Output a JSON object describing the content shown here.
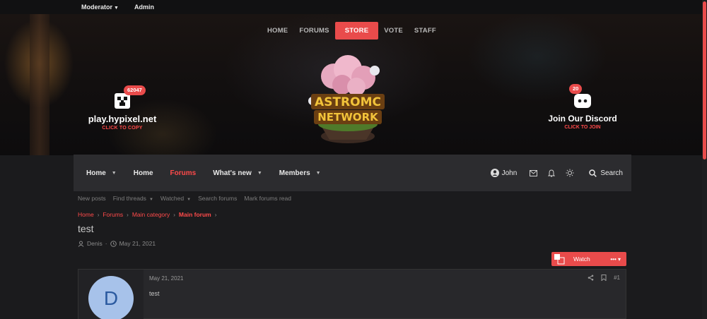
{
  "adminbar": {
    "moderator": "Moderator",
    "admin": "Admin"
  },
  "nav": {
    "home": "HOME",
    "forums": "FORUMS",
    "store": "STORE",
    "vote": "VOTE",
    "staff": "STAFF"
  },
  "server": {
    "title": "play.hypixel.net",
    "sub": "CLICK TO COPY",
    "badge": "62047"
  },
  "discord": {
    "title": "Join Our Discord",
    "sub": "CLICK TO JOIN",
    "badge": "20"
  },
  "logo": {
    "alt": "ASTROMC NETWORK"
  },
  "mainnav": {
    "tabs": [
      "Home",
      "Home",
      "Forums",
      "What's new",
      "Members"
    ],
    "user": "John",
    "search": "Search"
  },
  "subnav": [
    "New posts",
    "Find threads",
    "Watched",
    "Search forums",
    "Mark forums read"
  ],
  "breadcrumb": [
    "Home",
    "Forums",
    "Main category",
    "Main forum"
  ],
  "thread": {
    "title": "test",
    "author": "Denis",
    "date": "May 21, 2021",
    "watch_label": "Watch",
    "more": "•••"
  },
  "post": {
    "avatar_letter": "D",
    "date": "May 21, 2021",
    "body": "test",
    "number": "#1"
  },
  "colors": {
    "accent": "#e94b4b",
    "background": "#1b1b1d",
    "navbar": "#2c2c2f",
    "avatar": "#a7c2ea"
  },
  "icons": [
    "caret-down-icon",
    "creeper-icon",
    "discord-icon",
    "user-icon",
    "mail-icon",
    "bell-icon",
    "lightbulb-icon",
    "search-icon",
    "clock-icon",
    "share-icon",
    "bookmark-icon",
    "watch-icon"
  ]
}
